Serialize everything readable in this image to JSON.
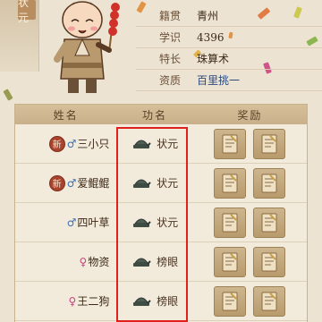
{
  "banner": {
    "char": "状元"
  },
  "profile": {
    "rows": [
      {
        "label": "籍贯",
        "value": "青州",
        "style": "normal"
      },
      {
        "label": "学识",
        "value": "4396",
        "style": "normal"
      },
      {
        "label": "特长",
        "value": "珠算术",
        "style": "normal"
      },
      {
        "label": "资质",
        "value": "百里挑一",
        "style": "blue"
      }
    ]
  },
  "table": {
    "headers": {
      "name": "姓名",
      "title": "功名",
      "reward": "奖励"
    },
    "rows": [
      {
        "is_new": true,
        "new_label": "新",
        "gender": "♂",
        "gender_type": "male",
        "name": "三小只",
        "title": "状元"
      },
      {
        "is_new": true,
        "new_label": "新",
        "gender": "♂",
        "gender_type": "male",
        "name": "爱鲲鲲",
        "title": "状元"
      },
      {
        "is_new": false,
        "new_label": "",
        "gender": "♂",
        "gender_type": "male",
        "name": "四叶草",
        "title": "状元"
      },
      {
        "is_new": false,
        "new_label": "",
        "gender": "♀",
        "gender_type": "female",
        "name": "物资",
        "title": "榜眼"
      },
      {
        "is_new": false,
        "new_label": "",
        "gender": "♀",
        "gender_type": "female",
        "name": "王二狗",
        "title": "榜眼"
      }
    ]
  },
  "colors": {
    "highlight": "#e0201c",
    "blue_text": "#2d4a7a",
    "new_badge": "#a8432d"
  },
  "icons": {
    "title": "scholar-hat-icon",
    "reward": "scroll-book-icon"
  }
}
